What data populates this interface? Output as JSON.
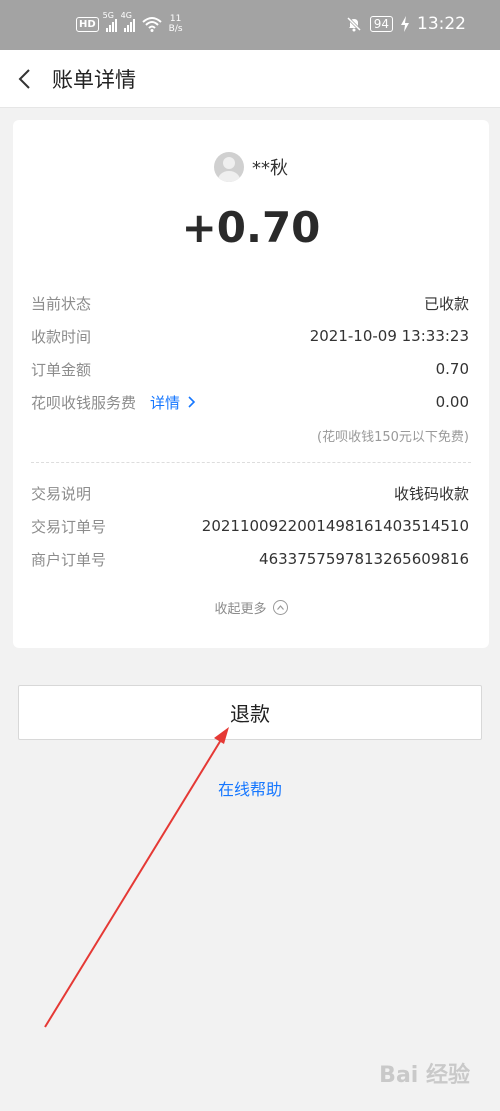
{
  "status_bar": {
    "network_speed_value": "11",
    "network_speed_unit": "B/s",
    "battery": "94",
    "time": "13:22",
    "hd_label": "HD",
    "net_1": "5G",
    "net_2": "4G"
  },
  "header": {
    "title": "账单详情"
  },
  "payer": {
    "name": "**秋"
  },
  "amount": "+0.70",
  "details": [
    {
      "label": "当前状态",
      "value": "已收款"
    },
    {
      "label": "收款时间",
      "value": "2021-10-09 13:33:23"
    },
    {
      "label": "订单金额",
      "value": "0.70"
    },
    {
      "label": "花呗收钱服务费",
      "value": "0.00",
      "link": "详情"
    }
  ],
  "fee_note": "(花呗收钱150元以下免费)",
  "details_2": [
    {
      "label": "交易说明",
      "value": "收钱码收款"
    },
    {
      "label": "交易订单号",
      "value": "2021100922001498161403514510"
    },
    {
      "label": "商户订单号",
      "value": "4633757597813265609816"
    }
  ],
  "collapse_label": "收起更多",
  "refund_label": "退款",
  "help_label": "在线帮助",
  "watermark": "Bai 经验",
  "colors": {
    "link": "#1677ff",
    "status_bar": "#a3a3a3",
    "arrow": "#e53935"
  },
  "icons": [
    "hd-icon",
    "signal-5g-icon",
    "signal-4g-icon",
    "wifi-icon",
    "mute-bell-icon",
    "battery-icon",
    "charging-icon",
    "back-chevron-icon",
    "avatar-icon",
    "chevron-up-icon"
  ]
}
